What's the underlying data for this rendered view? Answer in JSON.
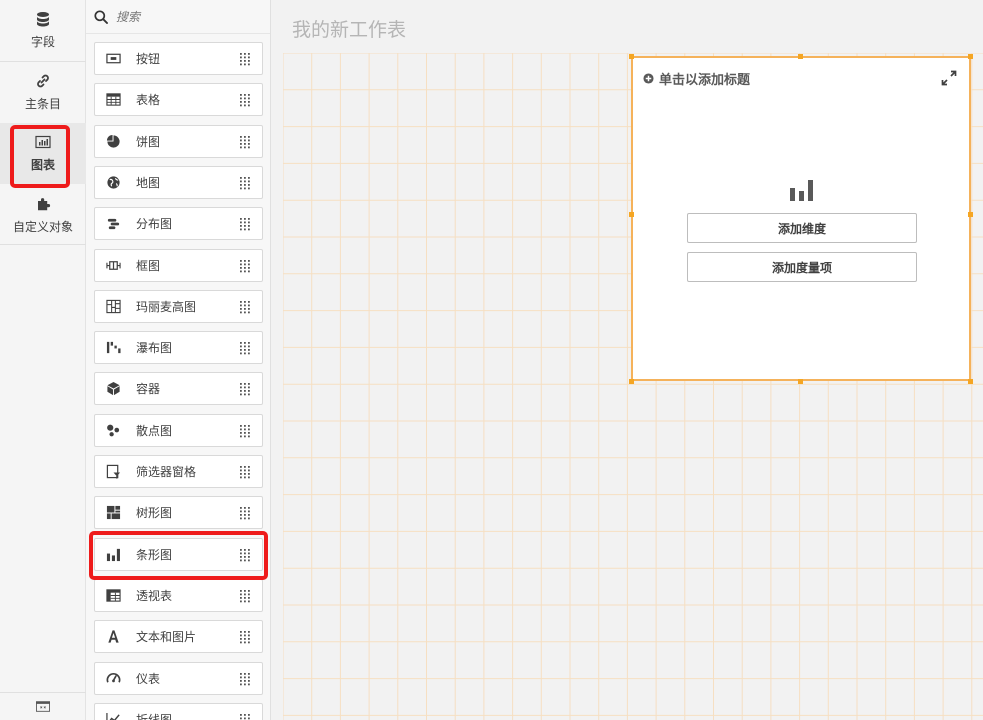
{
  "nav": {
    "items": [
      {
        "label": "字段",
        "icon": "database-icon"
      },
      {
        "label": "主条目",
        "icon": "link-icon"
      },
      {
        "label": "图表",
        "icon": "chart-icon"
      },
      {
        "label": "自定义对象",
        "icon": "puzzle-icon"
      }
    ],
    "active": "图表"
  },
  "assets": {
    "search_placeholder": "搜索",
    "items": [
      {
        "label": "按钮",
        "icon": "button-icon"
      },
      {
        "label": "表格",
        "icon": "table-icon"
      },
      {
        "label": "饼图",
        "icon": "pie-chart-icon"
      },
      {
        "label": "地图",
        "icon": "globe-icon"
      },
      {
        "label": "分布图",
        "icon": "distribution-plot-icon"
      },
      {
        "label": "框图",
        "icon": "box-plot-icon"
      },
      {
        "label": "玛丽麦高图",
        "icon": "mekko-chart-icon"
      },
      {
        "label": "瀑布图",
        "icon": "waterfall-chart-icon"
      },
      {
        "label": "容器",
        "icon": "container-icon"
      },
      {
        "label": "散点图",
        "icon": "scatter-plot-icon"
      },
      {
        "label": "筛选器窗格",
        "icon": "filter-pane-icon"
      },
      {
        "label": "树形图",
        "icon": "treemap-icon"
      },
      {
        "label": "条形图",
        "icon": "bar-chart-icon"
      },
      {
        "label": "透视表",
        "icon": "pivot-table-icon"
      },
      {
        "label": "文本和图片",
        "icon": "text-image-icon"
      },
      {
        "label": "仪表",
        "icon": "gauge-icon"
      },
      {
        "label": "折线图",
        "icon": "line-chart-icon"
      }
    ]
  },
  "sheet": {
    "title": "我的新工作表"
  },
  "chart": {
    "title_placeholder": "单击以添加标题",
    "add_dimension": "添加维度",
    "add_measure": "添加度量项"
  },
  "colors": {
    "highlight": "#ee1b1b",
    "selection": "#f5a623",
    "grid": "#f6dfc2"
  }
}
